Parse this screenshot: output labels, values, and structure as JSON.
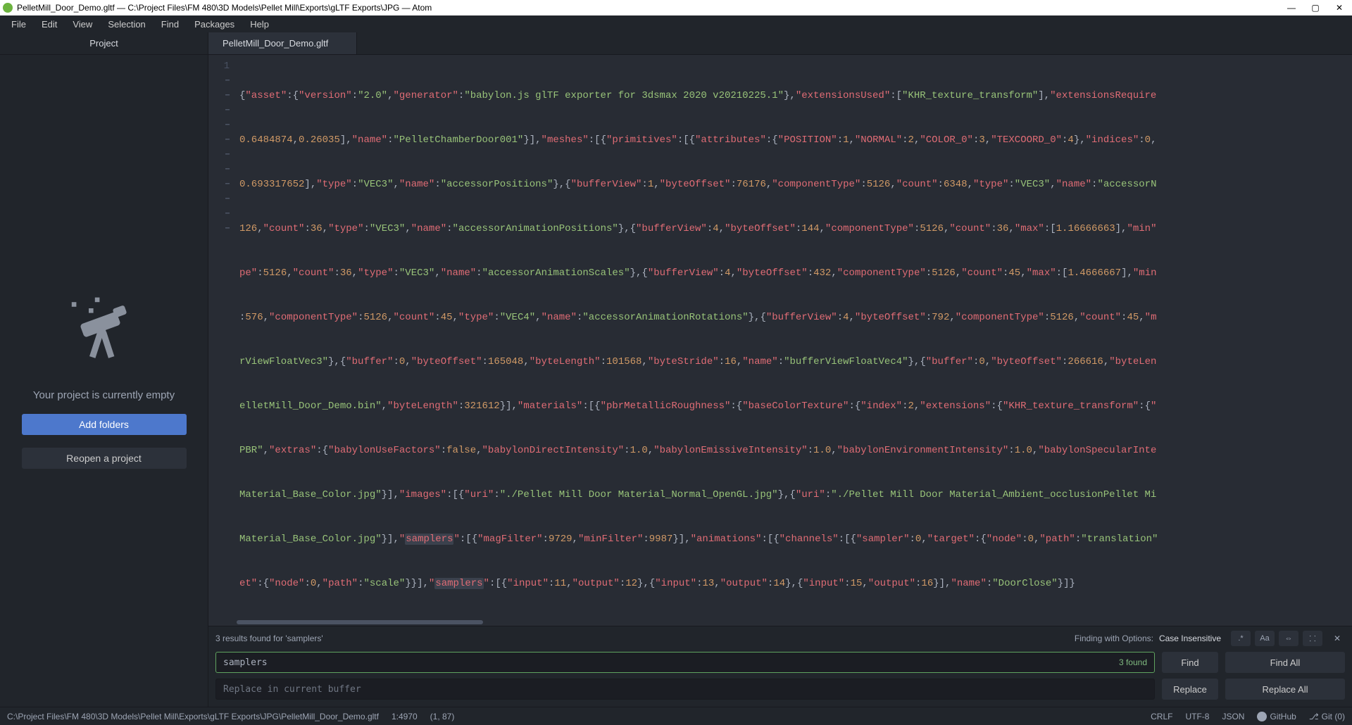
{
  "window": {
    "title": "PelletMill_Door_Demo.gltf — C:\\Project Files\\FM 480\\3D Models\\Pellet Mill\\Exports\\gLTF Exports\\JPG — Atom"
  },
  "menu": [
    "File",
    "Edit",
    "View",
    "Selection",
    "Find",
    "Packages",
    "Help"
  ],
  "sidebar": {
    "tab": "Project",
    "empty_text": "Your project is currently empty",
    "add_folders": "Add folders",
    "reopen": "Reopen a project"
  },
  "tab": {
    "name": "PelletMill_Door_Demo.gltf"
  },
  "gutter": {
    "line1": "1"
  },
  "code": {
    "l1": "{\"asset\":{\"version\":\"2.0\",\"generator\":\"babylon.js glTF exporter for 3dsmax 2020 v20210225.1\"},\"extensionsUsed\":[\"KHR_texture_transform\"],\"extensionsRequire",
    "l2": "0.6484874,0.26035],\"name\":\"PelletChamberDoor001\"}],\"meshes\":[{\"primitives\":[{\"attributes\":{\"POSITION\":1,\"NORMAL\":2,\"COLOR_0\":3,\"TEXCOORD_0\":4},\"indices\":0,",
    "l3": "0.693317652],\"type\":\"VEC3\",\"name\":\"accessorPositions\"},{\"bufferView\":1,\"byteOffset\":76176,\"componentType\":5126,\"count\":6348,\"type\":\"VEC3\",\"name\":\"accessorN",
    "l4": "126,\"count\":36,\"type\":\"VEC3\",\"name\":\"accessorAnimationPositions\"},{\"bufferView\":4,\"byteOffset\":144,\"componentType\":5126,\"count\":36,\"max\":[1.16666663],\"min\"",
    "l5": "pe\":5126,\"count\":36,\"type\":\"VEC3\",\"name\":\"accessorAnimationScales\"},{\"bufferView\":4,\"byteOffset\":432,\"componentType\":5126,\"count\":45,\"max\":[1.4666667],\"min",
    "l6": ":576,\"componentType\":5126,\"count\":45,\"type\":\"VEC4\",\"name\":\"accessorAnimationRotations\"},{\"bufferView\":4,\"byteOffset\":792,\"componentType\":5126,\"count\":45,\"m",
    "l7": "rViewFloatVec3\"},{\"buffer\":0,\"byteOffset\":165048,\"byteLength\":101568,\"byteStride\":16,\"name\":\"bufferViewFloatVec4\"},{\"buffer\":0,\"byteOffset\":266616,\"byteLen",
    "l8": "elletMill_Door_Demo.bin\",\"byteLength\":321612}],\"materials\":[{\"pbrMetallicRoughness\":{\"baseColorTexture\":{\"index\":2,\"extensions\":{\"KHR_texture_transform\":{\"",
    "l9": "PBR\",\"extras\":{\"babylonUseFactors\":false,\"babylonDirectIntensity\":1.0,\"babylonEmissiveIntensity\":1.0,\"babylonEnvironmentIntensity\":1.0,\"babylonSpecularInte",
    "l10": "Material_Base_Color.jpg\"}],\"images\":[{\"uri\":\"./Pellet Mill Door Material_Normal_OpenGL.jpg\"},{\"uri\":\"./Pellet Mill Door Material_Ambient_occlusionPellet Mi",
    "l11a": "Material_Base_Color.jpg\"}],\"",
    "l11b": "samplers",
    "l11c": "\":[{\"magFilter\":9729,\"minFilter\":9987}],\"animations\":[{\"channels\":[{\"sampler\":0,\"target\":{\"node\":0,\"path\":\"translation\"",
    "l12a": "et\":{\"node\":0,\"path\":\"scale\"}}],\"",
    "l12b": "samplers",
    "l12c": "\":[{\"input\":11,\"output\":12},{\"input\":13,\"output\":14},{\"input\":15,\"output\":16}],\"name\":\"DoorClose\"}]}"
  },
  "find": {
    "results_text": "3 results found for 'samplers'",
    "opts_label": "Finding with Options:",
    "opts_value": "Case Insensitive",
    "search_value": "samplers",
    "search_count": "3 found",
    "replace_placeholder": "Replace in current buffer",
    "find_btn": "Find",
    "find_all_btn": "Find All",
    "replace_btn": "Replace",
    "replace_all_btn": "Replace All",
    "regex_btn": ".*",
    "case_btn": "Aa",
    "sel_btn": "⇔",
    "word_btn": "⸬"
  },
  "status": {
    "path": "C:\\Project Files\\FM 480\\3D Models\\Pellet Mill\\Exports\\gLTF Exports\\JPG\\PelletMill_Door_Demo.gltf",
    "pos": "1:4970",
    "sel": "(1, 87)",
    "eol": "CRLF",
    "encoding": "UTF-8",
    "grammar": "JSON",
    "github": "GitHub",
    "git": "Git (0)"
  }
}
